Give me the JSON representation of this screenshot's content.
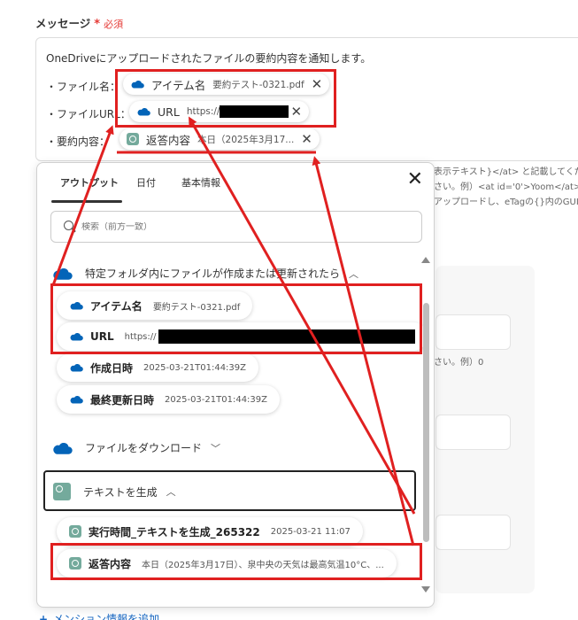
{
  "field": {
    "label": "メッセージ",
    "required_star": "*",
    "required_text": "必須"
  },
  "editor": {
    "line1": "OneDriveにアップロードされたファイルの要約内容を通知します。",
    "line2_label": "・ファイル名：",
    "line3_label": "・ファイルURL：",
    "line4_label": "・要約内容：",
    "chip_item_name": {
      "name": "アイテム名",
      "value": "要約テスト-0321.pdf"
    },
    "chip_url": {
      "name": "URL",
      "value": "https://"
    },
    "chip_answer": {
      "name": "返答内容",
      "value": "本日（2025年3月17..."
    }
  },
  "background": {
    "text1": "表示テキスト}</at> と記載してくださ",
    "text2": "さい。例）<at id='0'>Yoom</at>",
    "text3": "アップロードし、eTagの{}内のGUIDを",
    "text4": "さい。例）0"
  },
  "popup": {
    "tabs": [
      "アウトプット",
      "日付",
      "基本情報"
    ],
    "search_placeholder": "検索（前方一致）",
    "section1": "特定フォルダ内にファイルが作成または更新されたら",
    "items1": [
      {
        "name": "アイテム名",
        "value": "要約テスト-0321.pdf"
      },
      {
        "name": "URL",
        "value": "https://"
      },
      {
        "name": "作成日時",
        "value": "2025-03-21T01:44:39Z"
      },
      {
        "name": "最終更新日時",
        "value": "2025-03-21T01:44:39Z"
      }
    ],
    "section2": "ファイルをダウンロード",
    "section3": "テキストを生成",
    "items3": [
      {
        "name": "実行時間_テキストを生成_265322",
        "value": "2025-03-21 11:07"
      },
      {
        "name": "返答内容",
        "value": "本日（2025年3月17日）、泉中央の天気は最高気温10°C、..."
      }
    ]
  },
  "footer": {
    "add_mention": "メンション情報を追加"
  },
  "colors": {
    "annotation_red": "#e02020",
    "onedrive_blue": "#0364b8",
    "gpt_green": "#74aa9c"
  }
}
